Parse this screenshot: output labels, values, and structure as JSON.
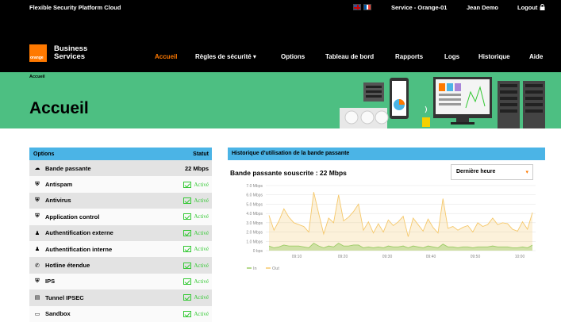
{
  "topbar": {
    "product": "Flexible Security Platform Cloud",
    "service": "Service - Orange-01",
    "user": "Jean Demo",
    "logout": "Logout"
  },
  "brand": {
    "logo_text": "orange",
    "line1": "Business",
    "line2": "Services",
    "accent": "#ff7900"
  },
  "nav": {
    "items": [
      {
        "label": "Accueil",
        "active": true
      },
      {
        "label": "Règles de sécurité ▾",
        "active": false
      },
      {
        "label": "Options",
        "active": false
      },
      {
        "label": "Tableau de bord",
        "active": false
      },
      {
        "label": "Rapports",
        "active": false
      },
      {
        "label": "Logs",
        "active": false
      },
      {
        "label": "Historique",
        "active": false
      },
      {
        "label": "Aide",
        "active": false
      }
    ]
  },
  "hero": {
    "breadcrumb": "Accueil",
    "title": "Accueil",
    "bg_color": "#4dbf82"
  },
  "options": {
    "header_left": "Options",
    "header_right": "Statut",
    "rows": [
      {
        "icon": "cloud-icon",
        "label": "Bande passante",
        "status": "22 Mbps"
      },
      {
        "icon": "shield-icon",
        "label": "Antispam",
        "status": "Activé"
      },
      {
        "icon": "shield-icon",
        "label": "Antivirus",
        "status": "Activé"
      },
      {
        "icon": "shield-icon",
        "label": "Application control",
        "status": "Activé"
      },
      {
        "icon": "users-icon",
        "label": "Authentification externe",
        "status": "Activé"
      },
      {
        "icon": "users-icon",
        "label": "Authentification interne",
        "status": "Activé"
      },
      {
        "icon": "phone-icon",
        "label": "Hotline étendue",
        "status": "Activé"
      },
      {
        "icon": "shield-icon",
        "label": "IPS",
        "status": "Activé"
      },
      {
        "icon": "tunnel-icon",
        "label": "Tunnel IPSEC",
        "status": "Activé"
      },
      {
        "icon": "monitor-icon",
        "label": "Sandbox",
        "status": "Activé"
      }
    ]
  },
  "bandwidth": {
    "header": "Historique d'utilisation de la bande passante",
    "subscribed": "Bande passante souscrite : 22 Mbps",
    "period": "Dernière heure"
  },
  "chart_data": {
    "type": "area",
    "ylim": [
      0,
      7
    ],
    "yticks": [
      "7.0 Mbps",
      "6.0 Mbps",
      "5.0 Mbps",
      "4.0 Mbps",
      "3.0 Mbps",
      "2.0 Mbps",
      "1.0 Mbps",
      "0 bps"
    ],
    "xticks": [
      "09:10",
      "09:20",
      "09:30",
      "09:40",
      "09:50",
      "10:00"
    ],
    "legend": [
      "In",
      "Out"
    ],
    "colors": {
      "In": "#9ccc65",
      "Out": "#f5c86b"
    },
    "series": [
      {
        "name": "Out",
        "values": [
          3.8,
          2.2,
          3.2,
          4.5,
          3.6,
          3.0,
          2.8,
          2.6,
          2.0,
          6.3,
          4.0,
          1.8,
          3.5,
          3.0,
          6.0,
          3.2,
          3.6,
          4.2,
          5.0,
          2.2,
          3.1,
          1.9,
          2.9,
          2.0,
          3.3,
          2.7,
          3.1,
          3.7,
          1.5,
          3.5,
          2.8,
          2.1,
          3.4,
          2.5,
          1.9,
          5.6,
          2.4,
          2.6,
          2.2,
          2.5,
          2.7,
          2.0,
          3.0,
          2.6,
          2.8,
          3.5,
          2.8,
          3.0,
          2.9,
          2.3,
          2.1,
          3.1,
          2.3,
          4.1
        ]
      },
      {
        "name": "In",
        "values": [
          0.5,
          0.3,
          0.4,
          0.6,
          0.5,
          0.5,
          0.5,
          0.4,
          0.3,
          0.8,
          0.5,
          0.3,
          0.5,
          0.4,
          0.8,
          0.5,
          0.5,
          0.6,
          0.6,
          0.3,
          0.4,
          0.3,
          0.4,
          0.3,
          0.5,
          0.4,
          0.4,
          0.5,
          0.3,
          0.5,
          0.4,
          0.3,
          0.5,
          0.4,
          0.3,
          0.7,
          0.4,
          0.4,
          0.3,
          0.4,
          0.4,
          0.3,
          0.4,
          0.4,
          0.4,
          0.5,
          0.4,
          0.4,
          0.4,
          0.3,
          0.3,
          0.4,
          0.3,
          0.6
        ]
      }
    ]
  }
}
